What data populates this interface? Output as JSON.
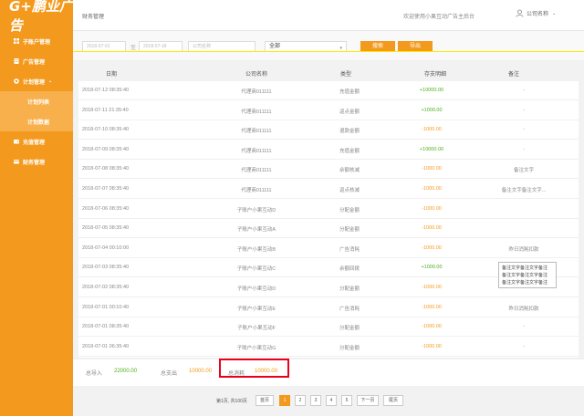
{
  "colors": {
    "accent": "#f39a1e",
    "positive": "#4caf1a",
    "highlight_box": "#e8001c"
  },
  "sidebar": {
    "logo": "G+鹏业广告",
    "items": [
      {
        "label": "子账户管理",
        "icon": "grid-icon"
      },
      {
        "label": "广告管理",
        "icon": "document-icon"
      },
      {
        "label": "计划管理",
        "icon": "plan-icon",
        "expanded": true
      },
      {
        "label": "计划列表",
        "sub": true
      },
      {
        "label": "计划数据",
        "sub": true
      },
      {
        "label": "充值管理",
        "icon": "wallet-icon"
      },
      {
        "label": "财务管理",
        "icon": "finance-icon",
        "active": true
      }
    ]
  },
  "header": {
    "title": "财务管理",
    "welcome": "欢迎使用小果互动广告主后台",
    "company": "公司名称"
  },
  "filters": {
    "start_date": "2018-07-01",
    "date_sep": "至",
    "end_date": "2018-07-18",
    "company_placeholder": "公司名称",
    "type_selected": "全部",
    "search_label": "搜索",
    "export_label": "导出"
  },
  "table": {
    "headers": [
      "日期",
      "公司名称",
      "类型",
      "存支明细",
      "备注"
    ],
    "rows": [
      {
        "date": "2018-07-12 08:35:40",
        "company": "代理商011111",
        "type": "充值金额",
        "amount": "+10000.00",
        "sign": "pos",
        "note": "-"
      },
      {
        "date": "2018-07-11 21:35:40",
        "company": "代理商011111",
        "type": "返点金额",
        "amount": "+1000.00",
        "sign": "pos",
        "note": "-"
      },
      {
        "date": "2018-07-10 08:35:40",
        "company": "代理商011111",
        "type": "退款金额",
        "amount": "-1000.00",
        "sign": "neg",
        "note": "-"
      },
      {
        "date": "2018-07-09 08:35:40",
        "company": "代理商011111",
        "type": "充值金额",
        "amount": "+10000.00",
        "sign": "pos",
        "note": "-"
      },
      {
        "date": "2018-07-08 08:35:40",
        "company": "代理商011111",
        "type": "余额核减",
        "amount": "-1000.00",
        "sign": "neg",
        "note": "备注文字"
      },
      {
        "date": "2018-07-07 08:35:40",
        "company": "代理商011111",
        "type": "返点核减",
        "amount": "-1000.00",
        "sign": "neg",
        "note": "备注文字备注文字..."
      },
      {
        "date": "2018-07-06 08:35:40",
        "company": "子账户小果互动D",
        "type": "分配金额",
        "amount": "-1000.00",
        "sign": "neg",
        "note": ""
      },
      {
        "date": "2018-07-05 08:35:40",
        "company": "子账户小果互动A",
        "type": "分配金额",
        "amount": "-1000.00",
        "sign": "neg",
        "note": ""
      },
      {
        "date": "2018-07-04 00:10:00",
        "company": "子账户小果互动B",
        "type": "广告消耗",
        "amount": "-1000.00",
        "sign": "neg",
        "note": "昨日消耗扣款"
      },
      {
        "date": "2018-07-03 08:35:40",
        "company": "子账户小果互动C",
        "type": "余额回拨",
        "amount": "+1000.00",
        "sign": "pos",
        "note": "-"
      },
      {
        "date": "2018-07-02 08:35:40",
        "company": "子账户小果互动D",
        "type": "分配金额",
        "amount": "-1000.00",
        "sign": "neg",
        "note": "-"
      },
      {
        "date": "2018-07-01 00:10:40",
        "company": "子账户小果互动E",
        "type": "广告消耗",
        "amount": "-1000.00",
        "sign": "neg",
        "note": "昨日消耗扣款"
      },
      {
        "date": "2018-07-01 08:35:40",
        "company": "子账户小果互动F",
        "type": "分配金额",
        "amount": "-1000.00",
        "sign": "neg",
        "note": "-"
      },
      {
        "date": "2018-07-01 06:35:40",
        "company": "子账户小果互动G",
        "type": "分配金额",
        "amount": "-1000.00",
        "sign": "neg",
        "note": "-"
      }
    ],
    "tooltip": [
      "备注文字备注文字备注",
      "备注文字备注文字备注",
      "备注文字备注文字备注"
    ]
  },
  "summary": {
    "income_label": "总导入",
    "income_value": "22000.00",
    "expense_label": "总支出",
    "expense_value": "10000.00",
    "consume_label": "总消耗",
    "consume_value": "10000.00"
  },
  "pager": {
    "info": "第1页, 共100页",
    "first": "首页",
    "pages": [
      "1",
      "2",
      "3",
      "4",
      "5"
    ],
    "next": "下一页",
    "last": "尾页"
  }
}
